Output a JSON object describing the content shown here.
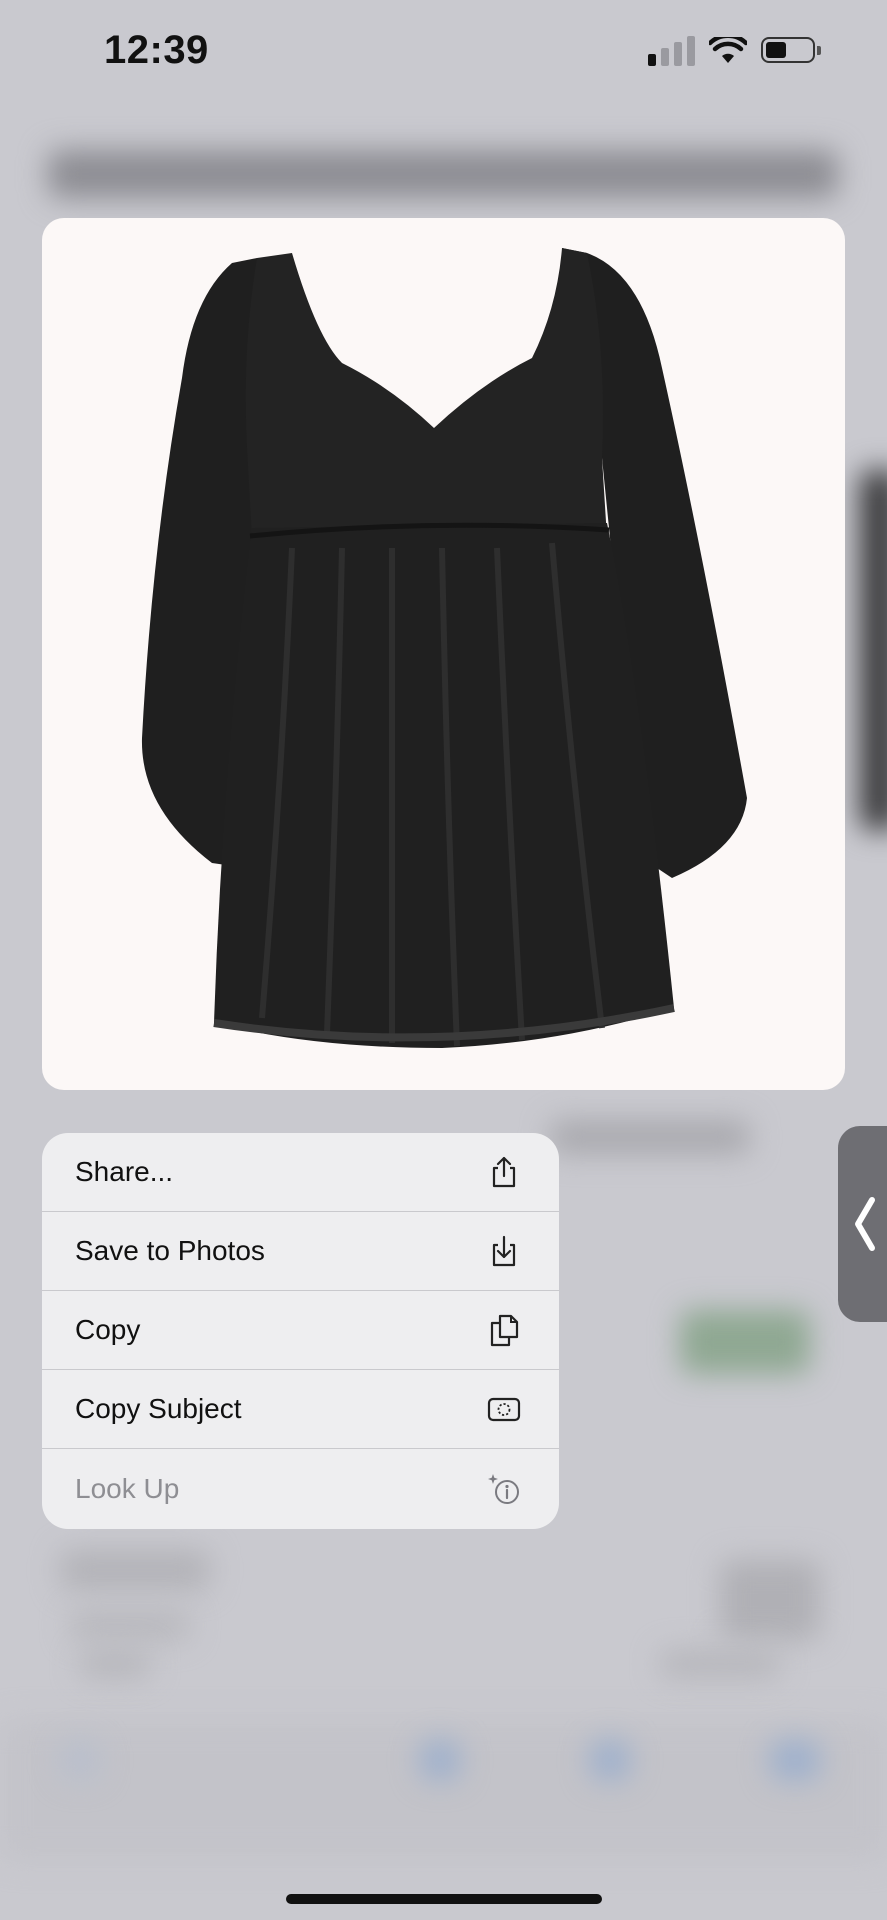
{
  "status_bar": {
    "time": "12:39",
    "signal_bars_active": 1,
    "signal_bars_total": 4,
    "battery_level": 0.45
  },
  "photo": {
    "subject": "black long-sleeve babydoll mini dress",
    "background_color": "#fcf8f7"
  },
  "context_menu": {
    "items": [
      {
        "label": "Share...",
        "icon": "share-icon",
        "enabled": true
      },
      {
        "label": "Save to Photos",
        "icon": "save-to-photos-icon",
        "enabled": true
      },
      {
        "label": "Copy",
        "icon": "copy-icon",
        "enabled": true
      },
      {
        "label": "Copy Subject",
        "icon": "copy-subject-icon",
        "enabled": true
      },
      {
        "label": "Look Up",
        "icon": "look-up-icon",
        "enabled": false
      }
    ]
  },
  "side_handle": {
    "icon": "chevron-left-icon"
  },
  "colors": {
    "menu_background": "#eeeef0",
    "text_primary": "#111111",
    "text_disabled": "#8e8e93",
    "backdrop": "#c9c9cf"
  }
}
